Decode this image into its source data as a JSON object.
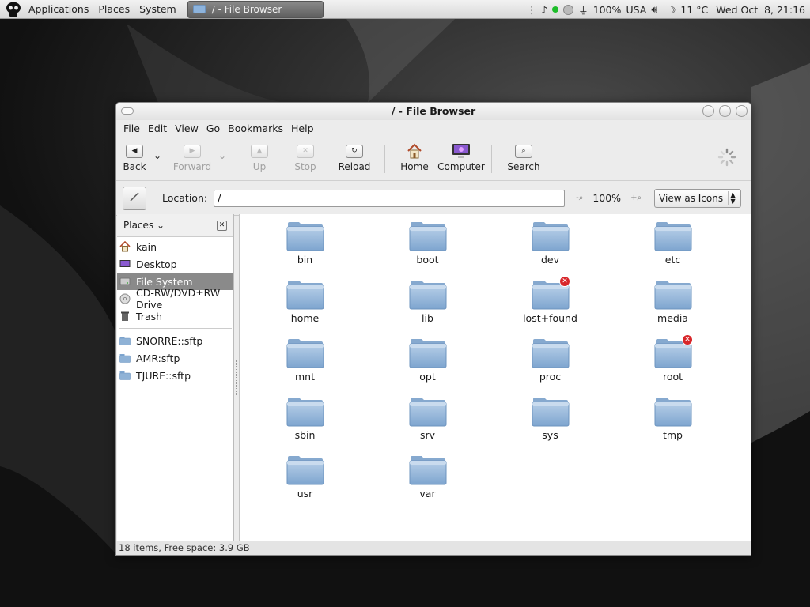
{
  "panel": {
    "menus": [
      "Applications",
      "Places",
      "System"
    ],
    "task_label": "/ - File Browser",
    "battery": "100%",
    "keyboard": "USA",
    "weather": "11 °C",
    "clock": "Wed Oct  8, 21:16"
  },
  "window": {
    "title": "/ - File Browser",
    "menubar": [
      "File",
      "Edit",
      "View",
      "Go",
      "Bookmarks",
      "Help"
    ],
    "toolbar": {
      "back": "Back",
      "forward": "Forward",
      "up": "Up",
      "stop": "Stop",
      "reload": "Reload",
      "home": "Home",
      "computer": "Computer",
      "search": "Search"
    },
    "location_label": "Location:",
    "location_value": "/",
    "zoom": "100%",
    "view_mode": "View as Icons"
  },
  "sidebar": {
    "title": "Places",
    "places": [
      {
        "label": "kain",
        "icon": "home-icon"
      },
      {
        "label": "Desktop",
        "icon": "desktop-icon"
      },
      {
        "label": "File System",
        "icon": "harddisk-icon",
        "selected": true
      },
      {
        "label": "CD-RW/DVD±RW Drive",
        "icon": "cdrom-icon"
      },
      {
        "label": "Trash",
        "icon": "trash-icon"
      }
    ],
    "bookmarks": [
      {
        "label": "SNORRE::sftp",
        "icon": "folder-icon"
      },
      {
        "label": "AMR:sftp",
        "icon": "folder-icon"
      },
      {
        "label": "TJURE::sftp",
        "icon": "folder-icon"
      }
    ]
  },
  "files": [
    {
      "name": "bin"
    },
    {
      "name": "boot"
    },
    {
      "name": "dev"
    },
    {
      "name": "etc"
    },
    {
      "name": "home"
    },
    {
      "name": "lib"
    },
    {
      "name": "lost+found",
      "locked": true
    },
    {
      "name": "media"
    },
    {
      "name": "mnt"
    },
    {
      "name": "opt"
    },
    {
      "name": "proc"
    },
    {
      "name": "root",
      "locked": true
    },
    {
      "name": "sbin"
    },
    {
      "name": "srv"
    },
    {
      "name": "sys"
    },
    {
      "name": "tmp"
    },
    {
      "name": "usr"
    },
    {
      "name": "var"
    }
  ],
  "status": "18 items, Free space: 3.9 GB",
  "colors": {
    "folder": "#8fb2d6",
    "selection": "#8a8a8a",
    "emblem": "#d8262a"
  }
}
